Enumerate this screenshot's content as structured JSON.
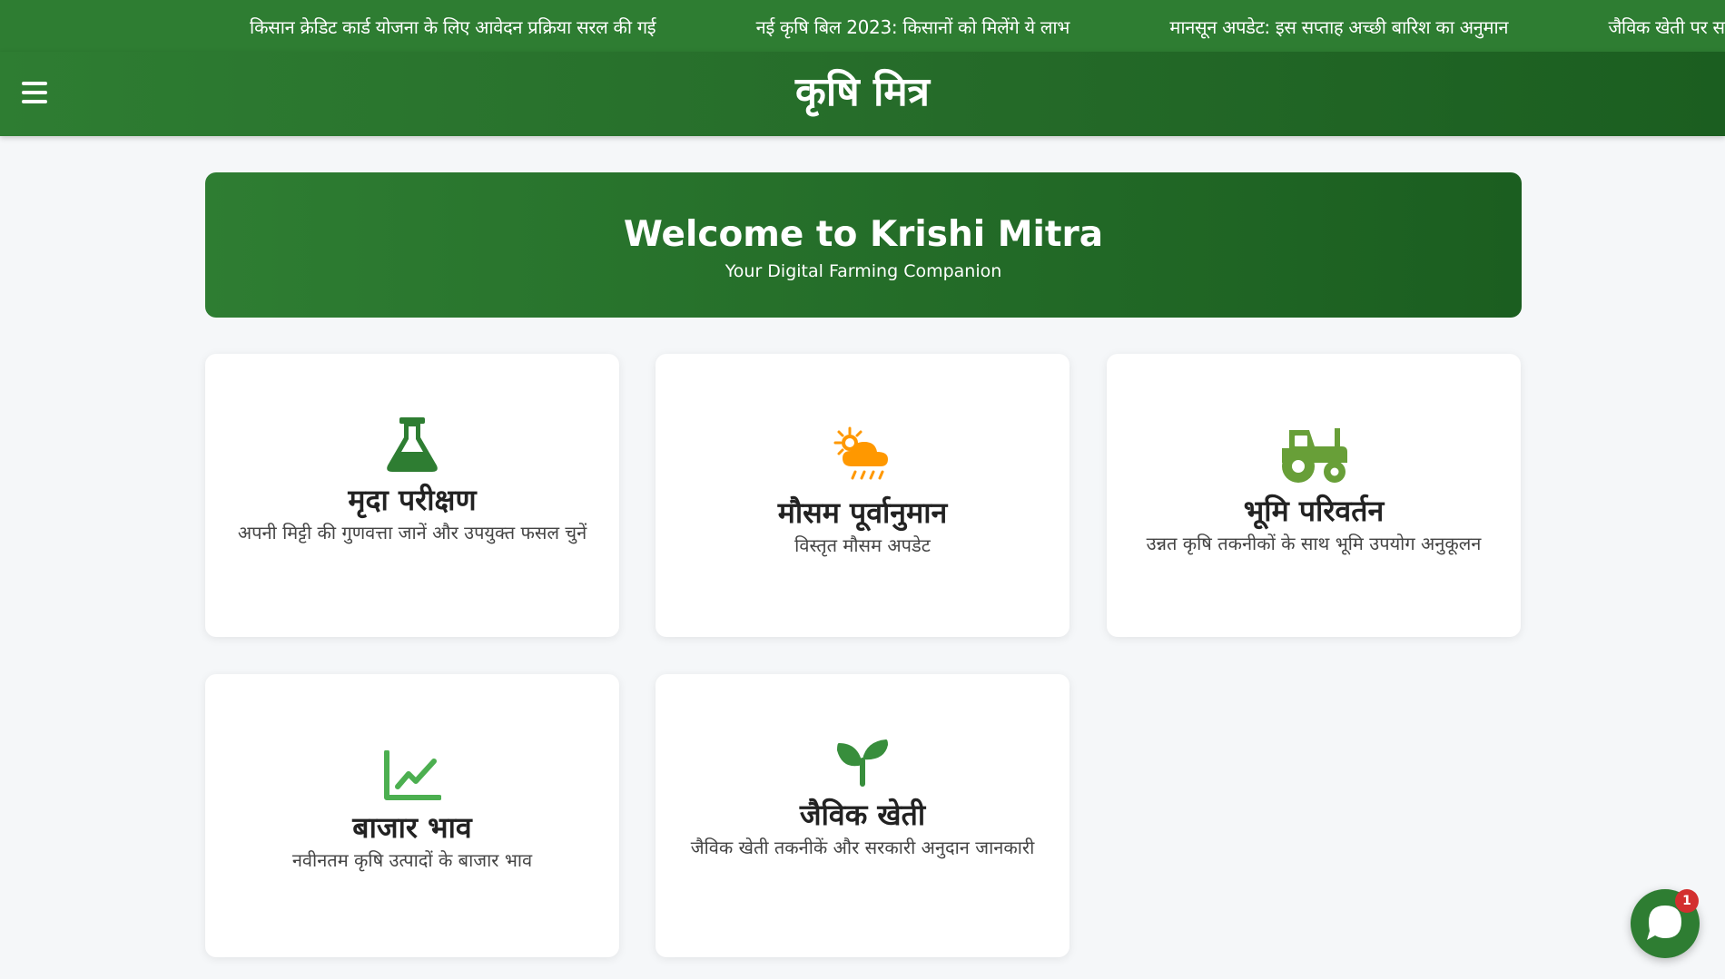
{
  "ticker": {
    "items": [
      "किसान क्रेडिट कार्ड योजना के लिए आवेदन प्रक्रिया सरल की गई",
      "नई कृषि बिल 2023: किसानों को मिलेंगे ये लाभ",
      "मानसून अपडेट: इस सप्ताह अच्छी बारिश का अनुमान",
      "जैविक खेती पर सरकार दे"
    ]
  },
  "header": {
    "menu_icon": "hamburger-menu-icon",
    "title": "कृषि मित्र"
  },
  "banner": {
    "title": "Welcome to Krishi Mitra",
    "subtitle": "Your Digital Farming Companion"
  },
  "cards": [
    {
      "icon": "flask-icon",
      "icon_color": "#2e7d32",
      "title": "मृदा परीक्षण",
      "description": "अपनी मिट्टी की गुणवत्ता जानें और उपयुक्त फसल चुनें"
    },
    {
      "icon": "cloud-sun-rain-icon",
      "icon_color": "#ff9800",
      "title": "मौसम पूर्वानुमान",
      "description": "विस्तृत मौसम अपडेट"
    },
    {
      "icon": "tractor-icon",
      "icon_color": "#689f38",
      "title": "भूमि परिवर्तन",
      "description": "उन्नत कृषि तकनीकों के साथ भूमि उपयोग अनुकूलन"
    },
    {
      "icon": "chart-line-icon",
      "icon_color": "#4caf50",
      "title": "बाजार भाव",
      "description": "नवीनतम कृषि उत्पादों के बाजार भाव"
    },
    {
      "icon": "seedling-icon",
      "icon_color": "#388e3c",
      "title": "जैविक खेती",
      "description": "जैविक खेती तकनीकें और सरकारी अनुदान जानकारी"
    }
  ],
  "chat": {
    "icon": "chat-bubble-icon",
    "badge_count": "1"
  },
  "colors": {
    "primary": "#2e7d32",
    "primary_dark": "#1b5e20",
    "background": "#f5f7f9",
    "badge": "#d32f2f"
  }
}
